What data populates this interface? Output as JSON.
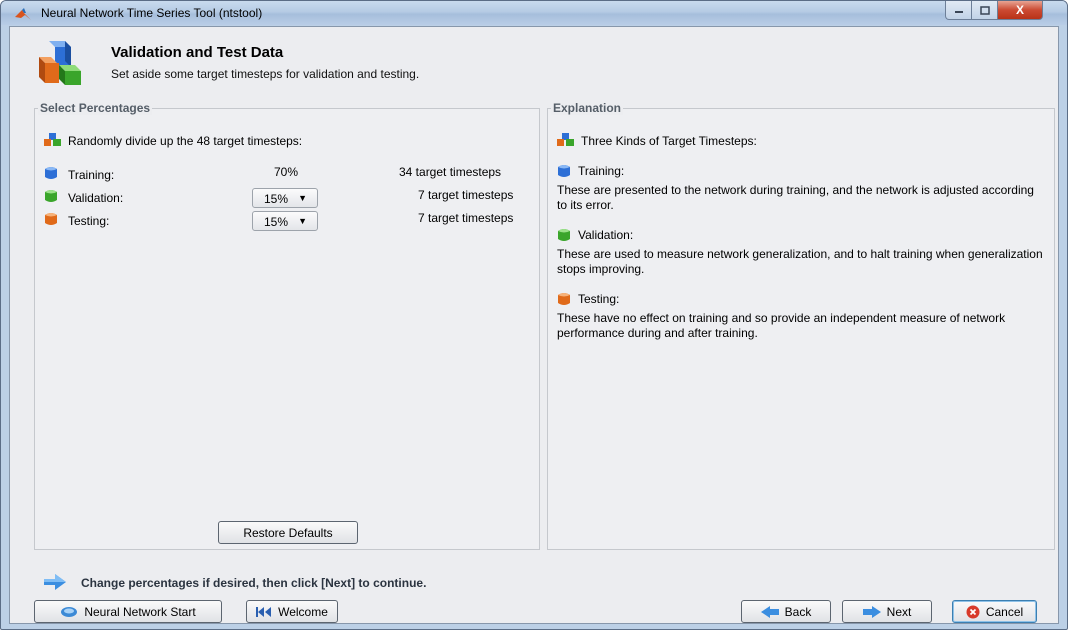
{
  "window": {
    "title": "Neural Network Time Series Tool (ntstool)",
    "close_glyph": "X"
  },
  "header": {
    "title": "Validation and Test Data",
    "subtitle": "Set aside some target timesteps for validation and testing.",
    "icon": "cubes-icon"
  },
  "left_panel": {
    "title": "Select Percentages",
    "intro": "Randomly divide up the 48 target timesteps:",
    "rows": [
      {
        "label": "Training:",
        "percent": "70%",
        "count": "34 target timesteps",
        "color": "#2d6fd6"
      },
      {
        "label": "Validation:",
        "percent": "15%",
        "count": "7 target timesteps",
        "color": "#3aa52b"
      },
      {
        "label": "Testing:",
        "percent": "15%",
        "count": "7 target timesteps",
        "color": "#e06a1a"
      }
    ],
    "restore_label": "Restore Defaults"
  },
  "right_panel": {
    "title": "Explanation",
    "heading": "Three Kinds of Target Timesteps:",
    "sections": [
      {
        "label": "Training:",
        "text": "These are presented to the network during training, and the network is adjusted according to its error."
      },
      {
        "label": "Validation:",
        "text": "These are used to measure network generalization, and to halt training when generalization stops improving."
      },
      {
        "label": "Testing:",
        "text": "These have no effect on training and so provide an independent measure of network performance during and after training."
      }
    ]
  },
  "footer": {
    "hint": "Change percentages if desired, then click [Next] to continue.",
    "buttons": {
      "start": "Neural Network Start",
      "welcome": "Welcome",
      "back": "Back",
      "next": "Next",
      "cancel": "Cancel"
    }
  },
  "colors": {
    "blue": "#2d6fd6",
    "green": "#3aa52b",
    "orange": "#e06a1a",
    "accent": "#3c7fb1"
  }
}
